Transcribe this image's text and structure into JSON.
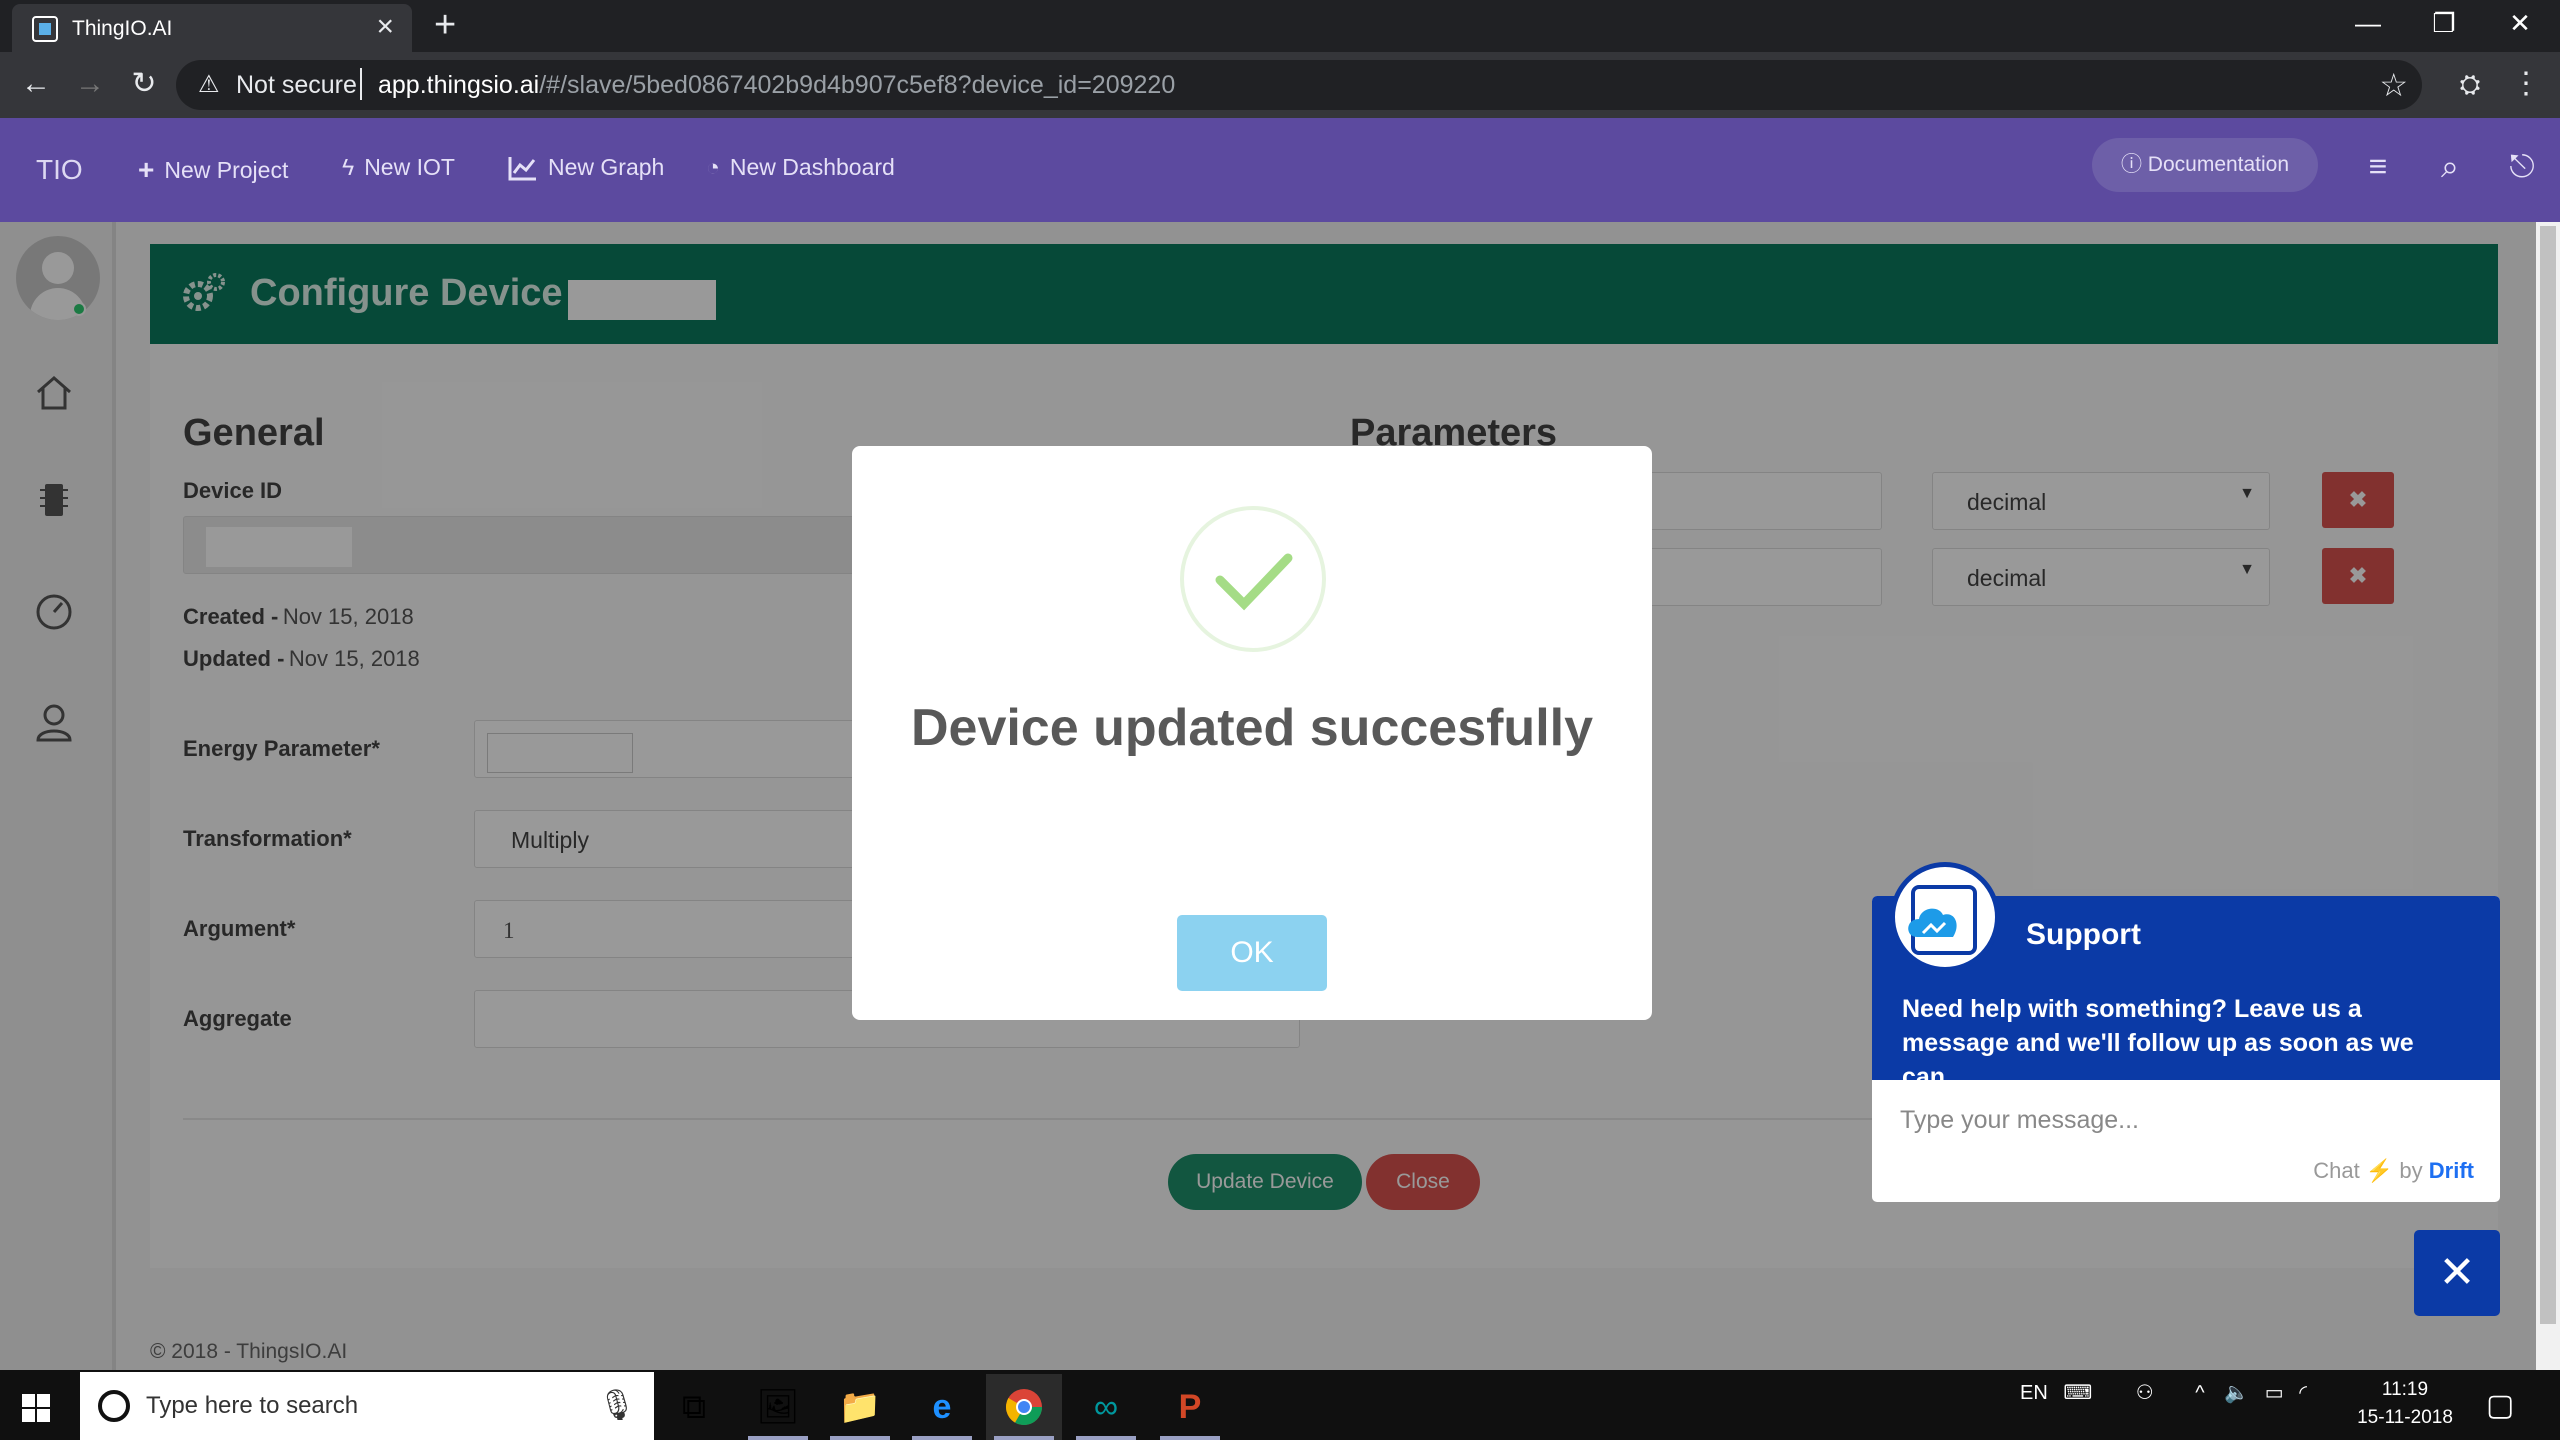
{
  "browser": {
    "tab_title": "ThingIO.AI",
    "not_secure": "Not secure",
    "url_host": "app.thingsio.ai",
    "url_path": "/#/slave/5bed0867402b9d4b907c5ef8?device_id=209220"
  },
  "app": {
    "brand": "TIO",
    "nav": [
      {
        "label": "New Project",
        "icon": "plus-icon"
      },
      {
        "label": "New IOT",
        "icon": "bolt-icon"
      },
      {
        "label": "New Graph",
        "icon": "line-chart-icon"
      },
      {
        "label": "New Dashboard",
        "icon": "dashboard-icon"
      }
    ],
    "documentation": "Documentation"
  },
  "page": {
    "header_title": "Configure Device -",
    "general": "General",
    "parameters": "Parameters",
    "device_id_label": "Device ID",
    "created_label": "Created -",
    "created_value": "Nov 15, 2018",
    "updated_label": "Updated -",
    "updated_value": "Nov 15, 2018",
    "energy_label": "Energy Parameter*",
    "transformation_label": "Transformation*",
    "transformation_value": "Multiply",
    "argument_label": "Argument*",
    "argument_value": "1",
    "aggregate_label": "Aggregate",
    "param_type_1": "decimal",
    "param_type_2": "decimal",
    "update_button": "Update Device",
    "close_button": "Close",
    "footer": "© 2018 - ThingsIO.AI"
  },
  "modal": {
    "message": "Device updated succesfully",
    "ok": "OK"
  },
  "chat": {
    "title": "Support",
    "help": "Need help with something? Leave us a message and we'll follow up as soon as we can.",
    "placeholder": "Type your message...",
    "by_prefix": "Chat",
    "by_mid": "by",
    "by_brand": "Drift"
  },
  "taskbar": {
    "search_placeholder": "Type here to search",
    "lang": "EN",
    "time": "11:19",
    "date": "15-11-2018"
  },
  "colors": {
    "app_header": "#5c4a9f",
    "panel_header": "#0a7a5e",
    "danger": "#d9534f",
    "ok_button": "#8cd2f0",
    "chat_blue": "#0b3aa6"
  }
}
